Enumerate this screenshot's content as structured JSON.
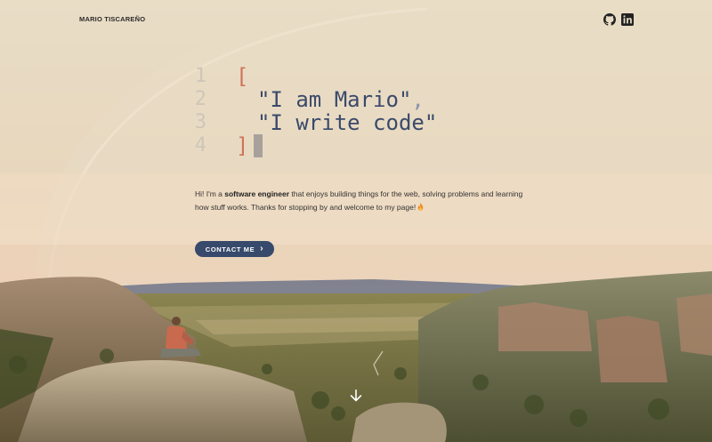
{
  "header": {
    "brand": "MARIO TISCAREÑO",
    "social_links": [
      {
        "name": "github-icon"
      },
      {
        "name": "linkedin-icon"
      }
    ]
  },
  "code_block": {
    "line_numbers": [
      "1",
      "2",
      "3",
      "4"
    ],
    "open_bracket": "[",
    "line1_string": "\"I am Mario\"",
    "line1_comma": ",",
    "line2_string": "\"I write code\"",
    "close_bracket": "]"
  },
  "intro": {
    "prefix": "Hi! I'm a ",
    "highlight": "software engineer",
    "suffix": " that enjoys building things for the web, solving problems and learning how stuff works. Thanks for stopping by and welcome to my page!",
    "emoji_icon": "fire-icon"
  },
  "cta": {
    "label": "CONTACT ME",
    "icon": "chevron-right-icon"
  },
  "scroll_down": {
    "icon": "arrow-down-icon"
  },
  "colors": {
    "accent": "#374a6b",
    "bracket": "#d0735a",
    "code_string": "#3b4a6b",
    "line_number": "#cfc6b8"
  }
}
